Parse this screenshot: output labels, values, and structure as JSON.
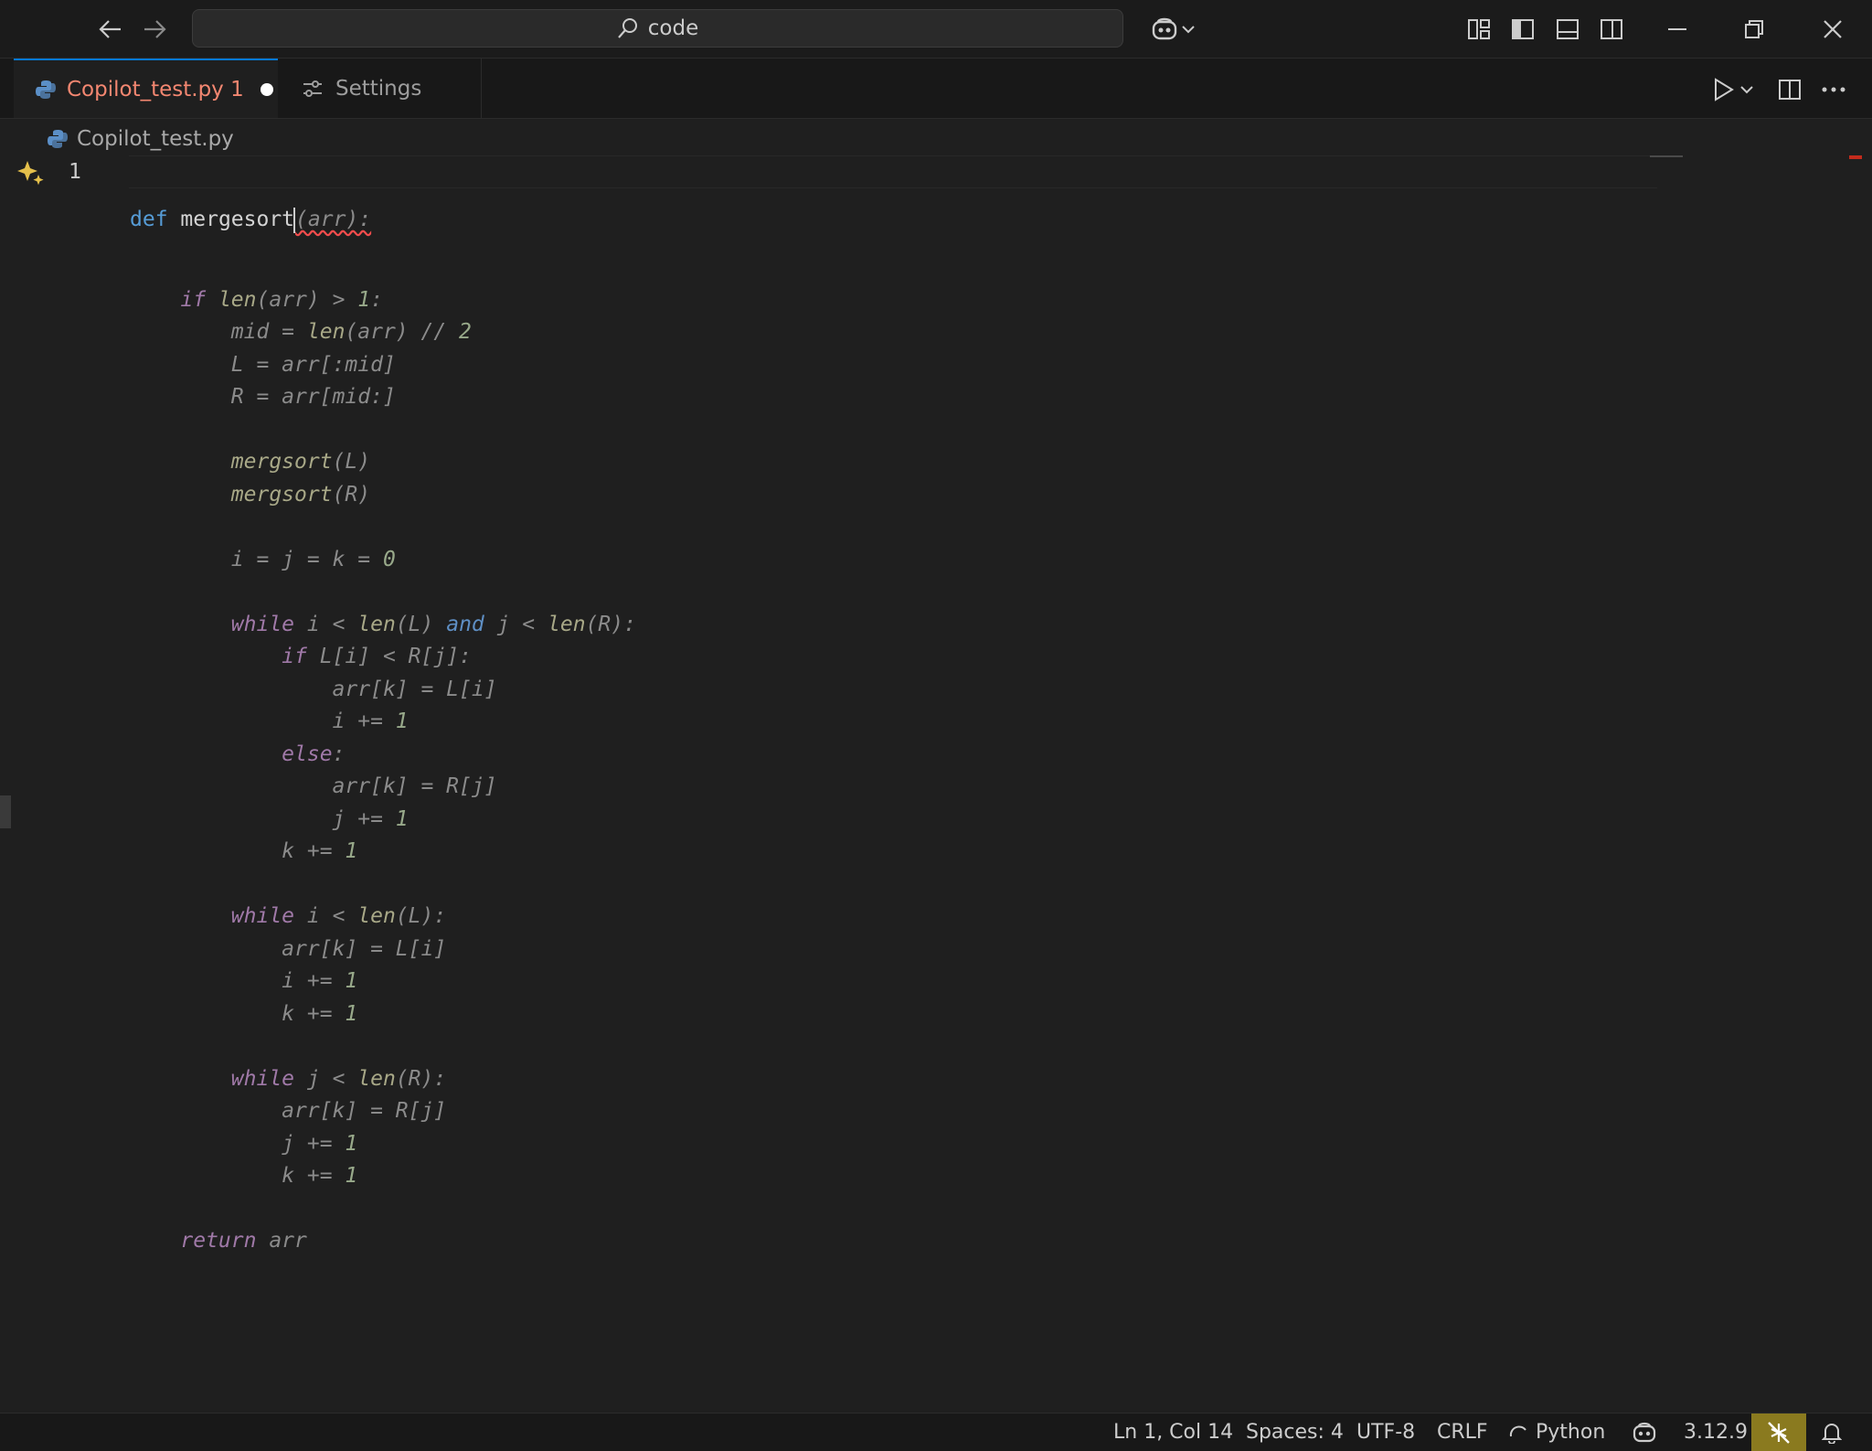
{
  "titlebar": {
    "search_text": "code"
  },
  "tabs": [
    {
      "label": "Copilot_test.py 1",
      "modified": true
    },
    {
      "label": "Settings"
    }
  ],
  "breadcrumb": {
    "file": "Copilot_test.py"
  },
  "editor": {
    "line_number": "1",
    "line1": {
      "kw": "def",
      "name": "mergesort",
      "ghost_rest": "(arr):"
    },
    "ghost_lines": [
      [
        {
          "t": "    ",
          "c": ""
        },
        {
          "t": "if",
          "c": "kw"
        },
        {
          "t": " ",
          "c": ""
        },
        {
          "t": "len",
          "c": "fn"
        },
        {
          "t": "(arr) > ",
          "c": ""
        },
        {
          "t": "1",
          "c": "num"
        },
        {
          "t": ":",
          "c": ""
        }
      ],
      [
        {
          "t": "        mid = ",
          "c": ""
        },
        {
          "t": "len",
          "c": "fn"
        },
        {
          "t": "(arr) // ",
          "c": ""
        },
        {
          "t": "2",
          "c": "num"
        }
      ],
      [
        {
          "t": "        L = arr[:mid]",
          "c": ""
        }
      ],
      [
        {
          "t": "        R = arr[mid:]",
          "c": ""
        }
      ],
      [
        {
          "t": "",
          "c": ""
        }
      ],
      [
        {
          "t": "        ",
          "c": ""
        },
        {
          "t": "mergsort",
          "c": "fn"
        },
        {
          "t": "(L)",
          "c": ""
        }
      ],
      [
        {
          "t": "        ",
          "c": ""
        },
        {
          "t": "mergsort",
          "c": "fn"
        },
        {
          "t": "(R)",
          "c": ""
        }
      ],
      [
        {
          "t": "",
          "c": ""
        }
      ],
      [
        {
          "t": "        i = j = k = ",
          "c": ""
        },
        {
          "t": "0",
          "c": "num"
        }
      ],
      [
        {
          "t": "",
          "c": ""
        }
      ],
      [
        {
          "t": "        ",
          "c": ""
        },
        {
          "t": "while",
          "c": "kw"
        },
        {
          "t": " i < ",
          "c": ""
        },
        {
          "t": "len",
          "c": "fn"
        },
        {
          "t": "(L) ",
          "c": ""
        },
        {
          "t": "and",
          "c": "blue"
        },
        {
          "t": " j < ",
          "c": ""
        },
        {
          "t": "len",
          "c": "fn"
        },
        {
          "t": "(R):",
          "c": ""
        }
      ],
      [
        {
          "t": "            ",
          "c": ""
        },
        {
          "t": "if",
          "c": "kw"
        },
        {
          "t": " L[i] < R[j]:",
          "c": ""
        }
      ],
      [
        {
          "t": "                arr[k] = L[i]",
          "c": ""
        }
      ],
      [
        {
          "t": "                i += ",
          "c": ""
        },
        {
          "t": "1",
          "c": "num"
        }
      ],
      [
        {
          "t": "            ",
          "c": ""
        },
        {
          "t": "else",
          "c": "kw"
        },
        {
          "t": ":",
          "c": ""
        }
      ],
      [
        {
          "t": "                arr[k] = R[j]",
          "c": ""
        }
      ],
      [
        {
          "t": "                j += ",
          "c": ""
        },
        {
          "t": "1",
          "c": "num"
        }
      ],
      [
        {
          "t": "            k += ",
          "c": ""
        },
        {
          "t": "1",
          "c": "num"
        }
      ],
      [
        {
          "t": "",
          "c": ""
        }
      ],
      [
        {
          "t": "        ",
          "c": ""
        },
        {
          "t": "while",
          "c": "kw"
        },
        {
          "t": " i < ",
          "c": ""
        },
        {
          "t": "len",
          "c": "fn"
        },
        {
          "t": "(L):",
          "c": ""
        }
      ],
      [
        {
          "t": "            arr[k] = L[i]",
          "c": ""
        }
      ],
      [
        {
          "t": "            i += ",
          "c": ""
        },
        {
          "t": "1",
          "c": "num"
        }
      ],
      [
        {
          "t": "            k += ",
          "c": ""
        },
        {
          "t": "1",
          "c": "num"
        }
      ],
      [
        {
          "t": "",
          "c": ""
        }
      ],
      [
        {
          "t": "        ",
          "c": ""
        },
        {
          "t": "while",
          "c": "kw"
        },
        {
          "t": " j < ",
          "c": ""
        },
        {
          "t": "len",
          "c": "fn"
        },
        {
          "t": "(R):",
          "c": ""
        }
      ],
      [
        {
          "t": "            arr[k] = R[j]",
          "c": ""
        }
      ],
      [
        {
          "t": "            j += ",
          "c": ""
        },
        {
          "t": "1",
          "c": "num"
        }
      ],
      [
        {
          "t": "            k += ",
          "c": ""
        },
        {
          "t": "1",
          "c": "num"
        }
      ],
      [
        {
          "t": "",
          "c": ""
        }
      ],
      [
        {
          "t": "    ",
          "c": ""
        },
        {
          "t": "return",
          "c": "kw"
        },
        {
          "t": " arr",
          "c": ""
        }
      ]
    ]
  },
  "statusbar": {
    "position": "Ln 1, Col 14",
    "spaces": "Spaces: 4",
    "encoding": "UTF-8",
    "eol": "CRLF",
    "language": "Python",
    "version": "3.12.9"
  },
  "colors": {
    "accent": "#0078d4",
    "error_tab": "#f48771",
    "warning_bg": "#8a7a1f"
  }
}
